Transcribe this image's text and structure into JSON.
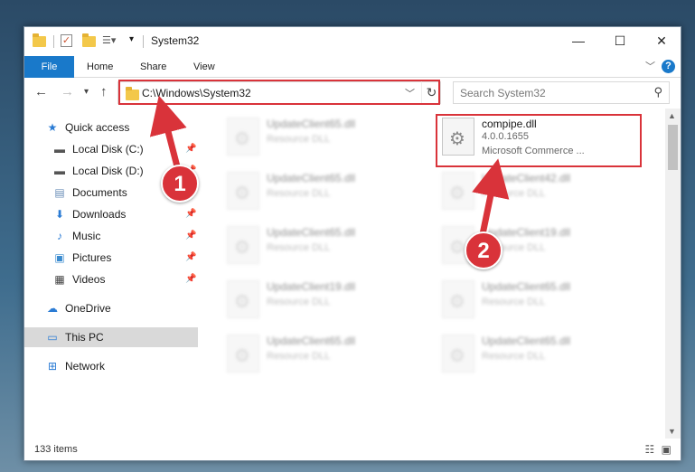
{
  "window": {
    "title": "System32",
    "minimize": "—",
    "maximize": "☐",
    "close": "✕"
  },
  "ribbon": {
    "tabs": [
      "File",
      "Home",
      "Share",
      "View"
    ],
    "help": "?"
  },
  "address": {
    "path": "C:\\Windows\\System32",
    "search_placeholder": "Search System32"
  },
  "sidebar": {
    "items": [
      {
        "label": "Quick access",
        "icon": "star-icon",
        "pinned": false
      },
      {
        "label": "Local Disk (C:)",
        "icon": "drive-icon",
        "pinned": true
      },
      {
        "label": "Local Disk (D:)",
        "icon": "drive-icon",
        "pinned": true
      },
      {
        "label": "Documents",
        "icon": "documents-icon",
        "pinned": true
      },
      {
        "label": "Downloads",
        "icon": "downloads-icon",
        "pinned": true
      },
      {
        "label": "Music",
        "icon": "music-icon",
        "pinned": true
      },
      {
        "label": "Pictures",
        "icon": "pictures-icon",
        "pinned": true
      },
      {
        "label": "Videos",
        "icon": "videos-icon",
        "pinned": true
      },
      {
        "label": "OneDrive",
        "icon": "cloud-icon",
        "pinned": false
      },
      {
        "label": "This PC",
        "icon": "pc-icon",
        "pinned": false,
        "selected": true
      },
      {
        "label": "Network",
        "icon": "network-icon",
        "pinned": false
      }
    ]
  },
  "files": [
    {
      "name": "UpdateClient65.dll",
      "desc": "Resource DLL"
    },
    {
      "name": "compipe.dll",
      "desc": "4.0.0.1655",
      "desc2": "Microsoft Commerce ..."
    },
    {
      "name": "UpdateClient65.dll",
      "desc": "Resource DLL"
    },
    {
      "name": "UpdateClient42.dll",
      "desc": "Resource DLL"
    },
    {
      "name": "UpdateClient65.dll",
      "desc": "Resource DLL"
    },
    {
      "name": "UpdateClient19.dll",
      "desc": "Resource DLL"
    },
    {
      "name": "UpdateClient19.dll",
      "desc": "Resource DLL"
    },
    {
      "name": "UpdateClient65.dll",
      "desc": "Resource DLL"
    },
    {
      "name": "UpdateClient65.dll",
      "desc": "Resource DLL"
    },
    {
      "name": "UpdateClient65.dll",
      "desc": "Resource DLL"
    }
  ],
  "status": {
    "count": "133 items"
  },
  "annotations": {
    "step1": "1",
    "step2": "2",
    "color": "#d9333a"
  }
}
